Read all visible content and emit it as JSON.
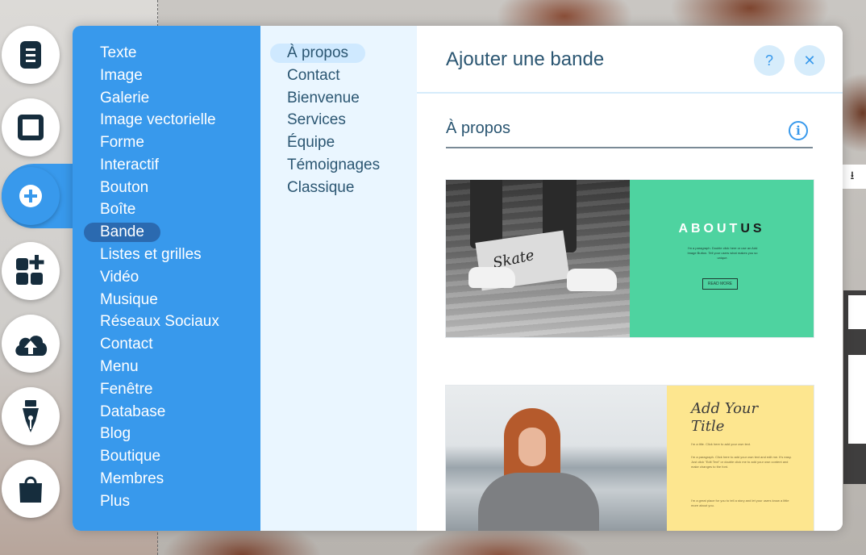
{
  "panel": {
    "title": "Ajouter une bande",
    "help_label": "?",
    "close_label": "✕"
  },
  "categories": [
    {
      "label": "Texte"
    },
    {
      "label": "Image"
    },
    {
      "label": "Galerie"
    },
    {
      "label": "Image vectorielle"
    },
    {
      "label": "Forme"
    },
    {
      "label": "Interactif"
    },
    {
      "label": "Bouton"
    },
    {
      "label": "Boîte"
    },
    {
      "label": "Bande",
      "selected": true
    },
    {
      "label": "Listes et grilles"
    },
    {
      "label": "Vidéo"
    },
    {
      "label": "Musique"
    },
    {
      "label": "Réseaux Sociaux"
    },
    {
      "label": "Contact"
    },
    {
      "label": "Menu"
    },
    {
      "label": "Fenêtre"
    },
    {
      "label": "Database"
    },
    {
      "label": "Blog"
    },
    {
      "label": "Boutique"
    },
    {
      "label": "Membres"
    },
    {
      "label": "Plus"
    }
  ],
  "subcategories": [
    {
      "label": "À propos",
      "selected": true
    },
    {
      "label": "Contact"
    },
    {
      "label": "Bienvenue"
    },
    {
      "label": "Services"
    },
    {
      "label": "Équipe"
    },
    {
      "label": "Témoignages"
    },
    {
      "label": "Classique"
    }
  ],
  "section": {
    "title": "À propos",
    "info_label": "i"
  },
  "thumbnails": {
    "about_us": {
      "heading_light": "ABOUT",
      "heading_dark": "US",
      "paragraph": "I'm a paragraph. Double click here or use an Add Image Button. Tell your users what makes you so unique.",
      "button": "READ MORE",
      "board_text": "Skate"
    },
    "add_your_title": {
      "title_line1": "Add Your",
      "title_line2": "Title",
      "intro": "I'm a title. Click here to add your own text.",
      "body1": "I'm a paragraph. Click here to add your own text and edit me. It's easy. Just click \"Edit Text\" or double click me to add your own content and make changes to the font.",
      "body2": "I'm a great place for you to tell a story and let your users know a little more about you."
    }
  },
  "toolbar": [
    {
      "icon": "page-icon"
    },
    {
      "icon": "square-icon"
    },
    {
      "icon": "plus-circle-icon",
      "active": true
    },
    {
      "icon": "apps-icon"
    },
    {
      "icon": "cloud-upload-icon"
    },
    {
      "icon": "pen-nib-icon"
    },
    {
      "icon": "shopping-bag-icon"
    }
  ],
  "colors": {
    "accent": "#3899ec",
    "selected_category": "#2b6ab0",
    "submenu_bg": "#eaf6ff",
    "title_text": "#2b5672",
    "thumb_green": "#4ed3a0",
    "thumb_yellow": "#fde68f"
  }
}
